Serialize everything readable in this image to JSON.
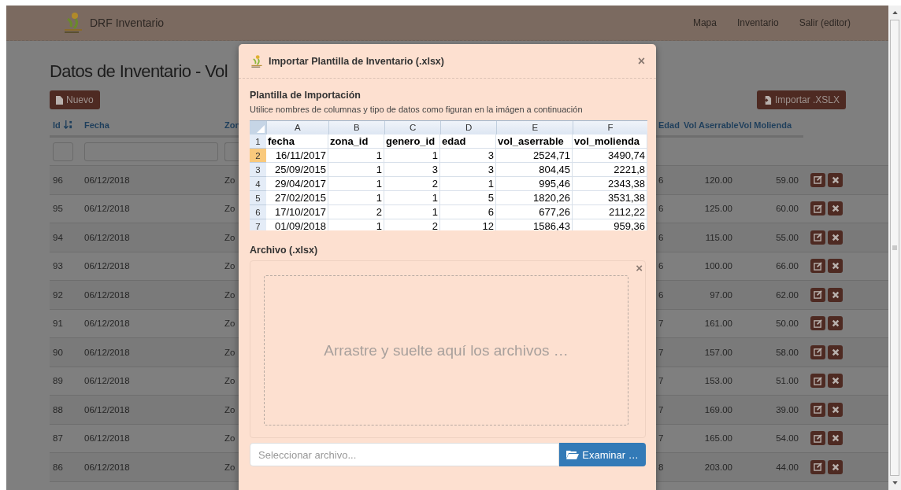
{
  "navbar": {
    "brand": "DRF Inventario",
    "links": [
      {
        "label": "Mapa"
      },
      {
        "label": "Inventario"
      },
      {
        "label": "Salir (editor)"
      }
    ]
  },
  "page": {
    "title": "Datos de Inventario - Vol",
    "new_button": "Nuevo",
    "import_button": "Importar .XSLX"
  },
  "table": {
    "columns": [
      {
        "label": "Id"
      },
      {
        "label": "Fecha"
      },
      {
        "label": "Zon"
      },
      {
        "label": "Edad"
      },
      {
        "label": "Vol Aserrable"
      },
      {
        "label": "Vol Molienda"
      }
    ],
    "rows": [
      {
        "id": "96",
        "fecha": "06/12/2018",
        "zona": "Zo",
        "edad": "6",
        "vol_aserrable": "120.00",
        "vol_molienda": "59.00"
      },
      {
        "id": "95",
        "fecha": "06/12/2018",
        "zona": "Zo",
        "edad": "6",
        "vol_aserrable": "125.00",
        "vol_molienda": "60.00"
      },
      {
        "id": "94",
        "fecha": "06/12/2018",
        "zona": "Zo",
        "edad": "6",
        "vol_aserrable": "115.00",
        "vol_molienda": "55.00"
      },
      {
        "id": "93",
        "fecha": "06/12/2018",
        "zona": "Zo",
        "edad": "6",
        "vol_aserrable": "100.00",
        "vol_molienda": "66.00"
      },
      {
        "id": "92",
        "fecha": "06/12/2018",
        "zona": "Zo",
        "edad": "6",
        "vol_aserrable": "97.00",
        "vol_molienda": "62.00"
      },
      {
        "id": "91",
        "fecha": "06/12/2018",
        "zona": "Zo",
        "edad": "7",
        "vol_aserrable": "161.00",
        "vol_molienda": "50.00"
      },
      {
        "id": "90",
        "fecha": "06/12/2018",
        "zona": "Zo",
        "edad": "7",
        "vol_aserrable": "157.00",
        "vol_molienda": "58.00"
      },
      {
        "id": "89",
        "fecha": "06/12/2018",
        "zona": "Zo",
        "edad": "7",
        "vol_aserrable": "153.00",
        "vol_molienda": "51.00"
      },
      {
        "id": "88",
        "fecha": "06/12/2018",
        "zona": "Zo",
        "edad": "7",
        "vol_aserrable": "169.00",
        "vol_molienda": "39.00"
      },
      {
        "id": "87",
        "fecha": "06/12/2018",
        "zona": "Zo",
        "edad": "7",
        "vol_aserrable": "165.00",
        "vol_molienda": "54.00"
      },
      {
        "id": "86",
        "fecha": "06/12/2018",
        "zona": "Zo",
        "edad": "8",
        "vol_aserrable": "203.00",
        "vol_molienda": "44.00"
      }
    ]
  },
  "modal": {
    "title": "Importar Plantilla de Inventario (.xlsx)",
    "close": "×",
    "section_title": "Plantilla de Importación",
    "hint": "Utilice nombres de columnas y tipo de datos como figuran en la imágen a continuación",
    "sheet": {
      "columns": [
        "A",
        "B",
        "C",
        "D",
        "E",
        "F"
      ],
      "rows": [
        {
          "number": "1",
          "kind": "header",
          "selected": false,
          "cells": [
            "fecha",
            "zona_id",
            "genero_id",
            "edad",
            "vol_aserrable",
            "vol_molienda"
          ]
        },
        {
          "number": "2",
          "kind": "data",
          "selected": true,
          "cells": [
            "16/11/2017",
            "1",
            "1",
            "3",
            "2524,71",
            "3490,74"
          ]
        },
        {
          "number": "3",
          "kind": "data",
          "selected": false,
          "cells": [
            "25/09/2015",
            "1",
            "3",
            "3",
            "804,45",
            "2221,8"
          ]
        },
        {
          "number": "4",
          "kind": "data",
          "selected": false,
          "cells": [
            "29/04/2017",
            "1",
            "2",
            "1",
            "995,46",
            "2343,38"
          ]
        },
        {
          "number": "5",
          "kind": "data",
          "selected": false,
          "cells": [
            "27/02/2015",
            "1",
            "1",
            "5",
            "1820,26",
            "3531,38"
          ]
        },
        {
          "number": "6",
          "kind": "data",
          "selected": false,
          "cells": [
            "17/10/2017",
            "2",
            "1",
            "6",
            "677,26",
            "2112,22"
          ]
        },
        {
          "number": "7",
          "kind": "data",
          "selected": false,
          "cells": [
            "01/09/2018",
            "1",
            "2",
            "12",
            "1586,43",
            "959,36"
          ]
        }
      ]
    },
    "file_label": "Archivo (.xlsx)",
    "dropzone": {
      "close": "×",
      "text": "Arrastre y suelte aquí los archivos …"
    },
    "file_input": {
      "placeholder": "Seleccionar archivo..."
    },
    "browse_button": "Examinar …"
  }
}
